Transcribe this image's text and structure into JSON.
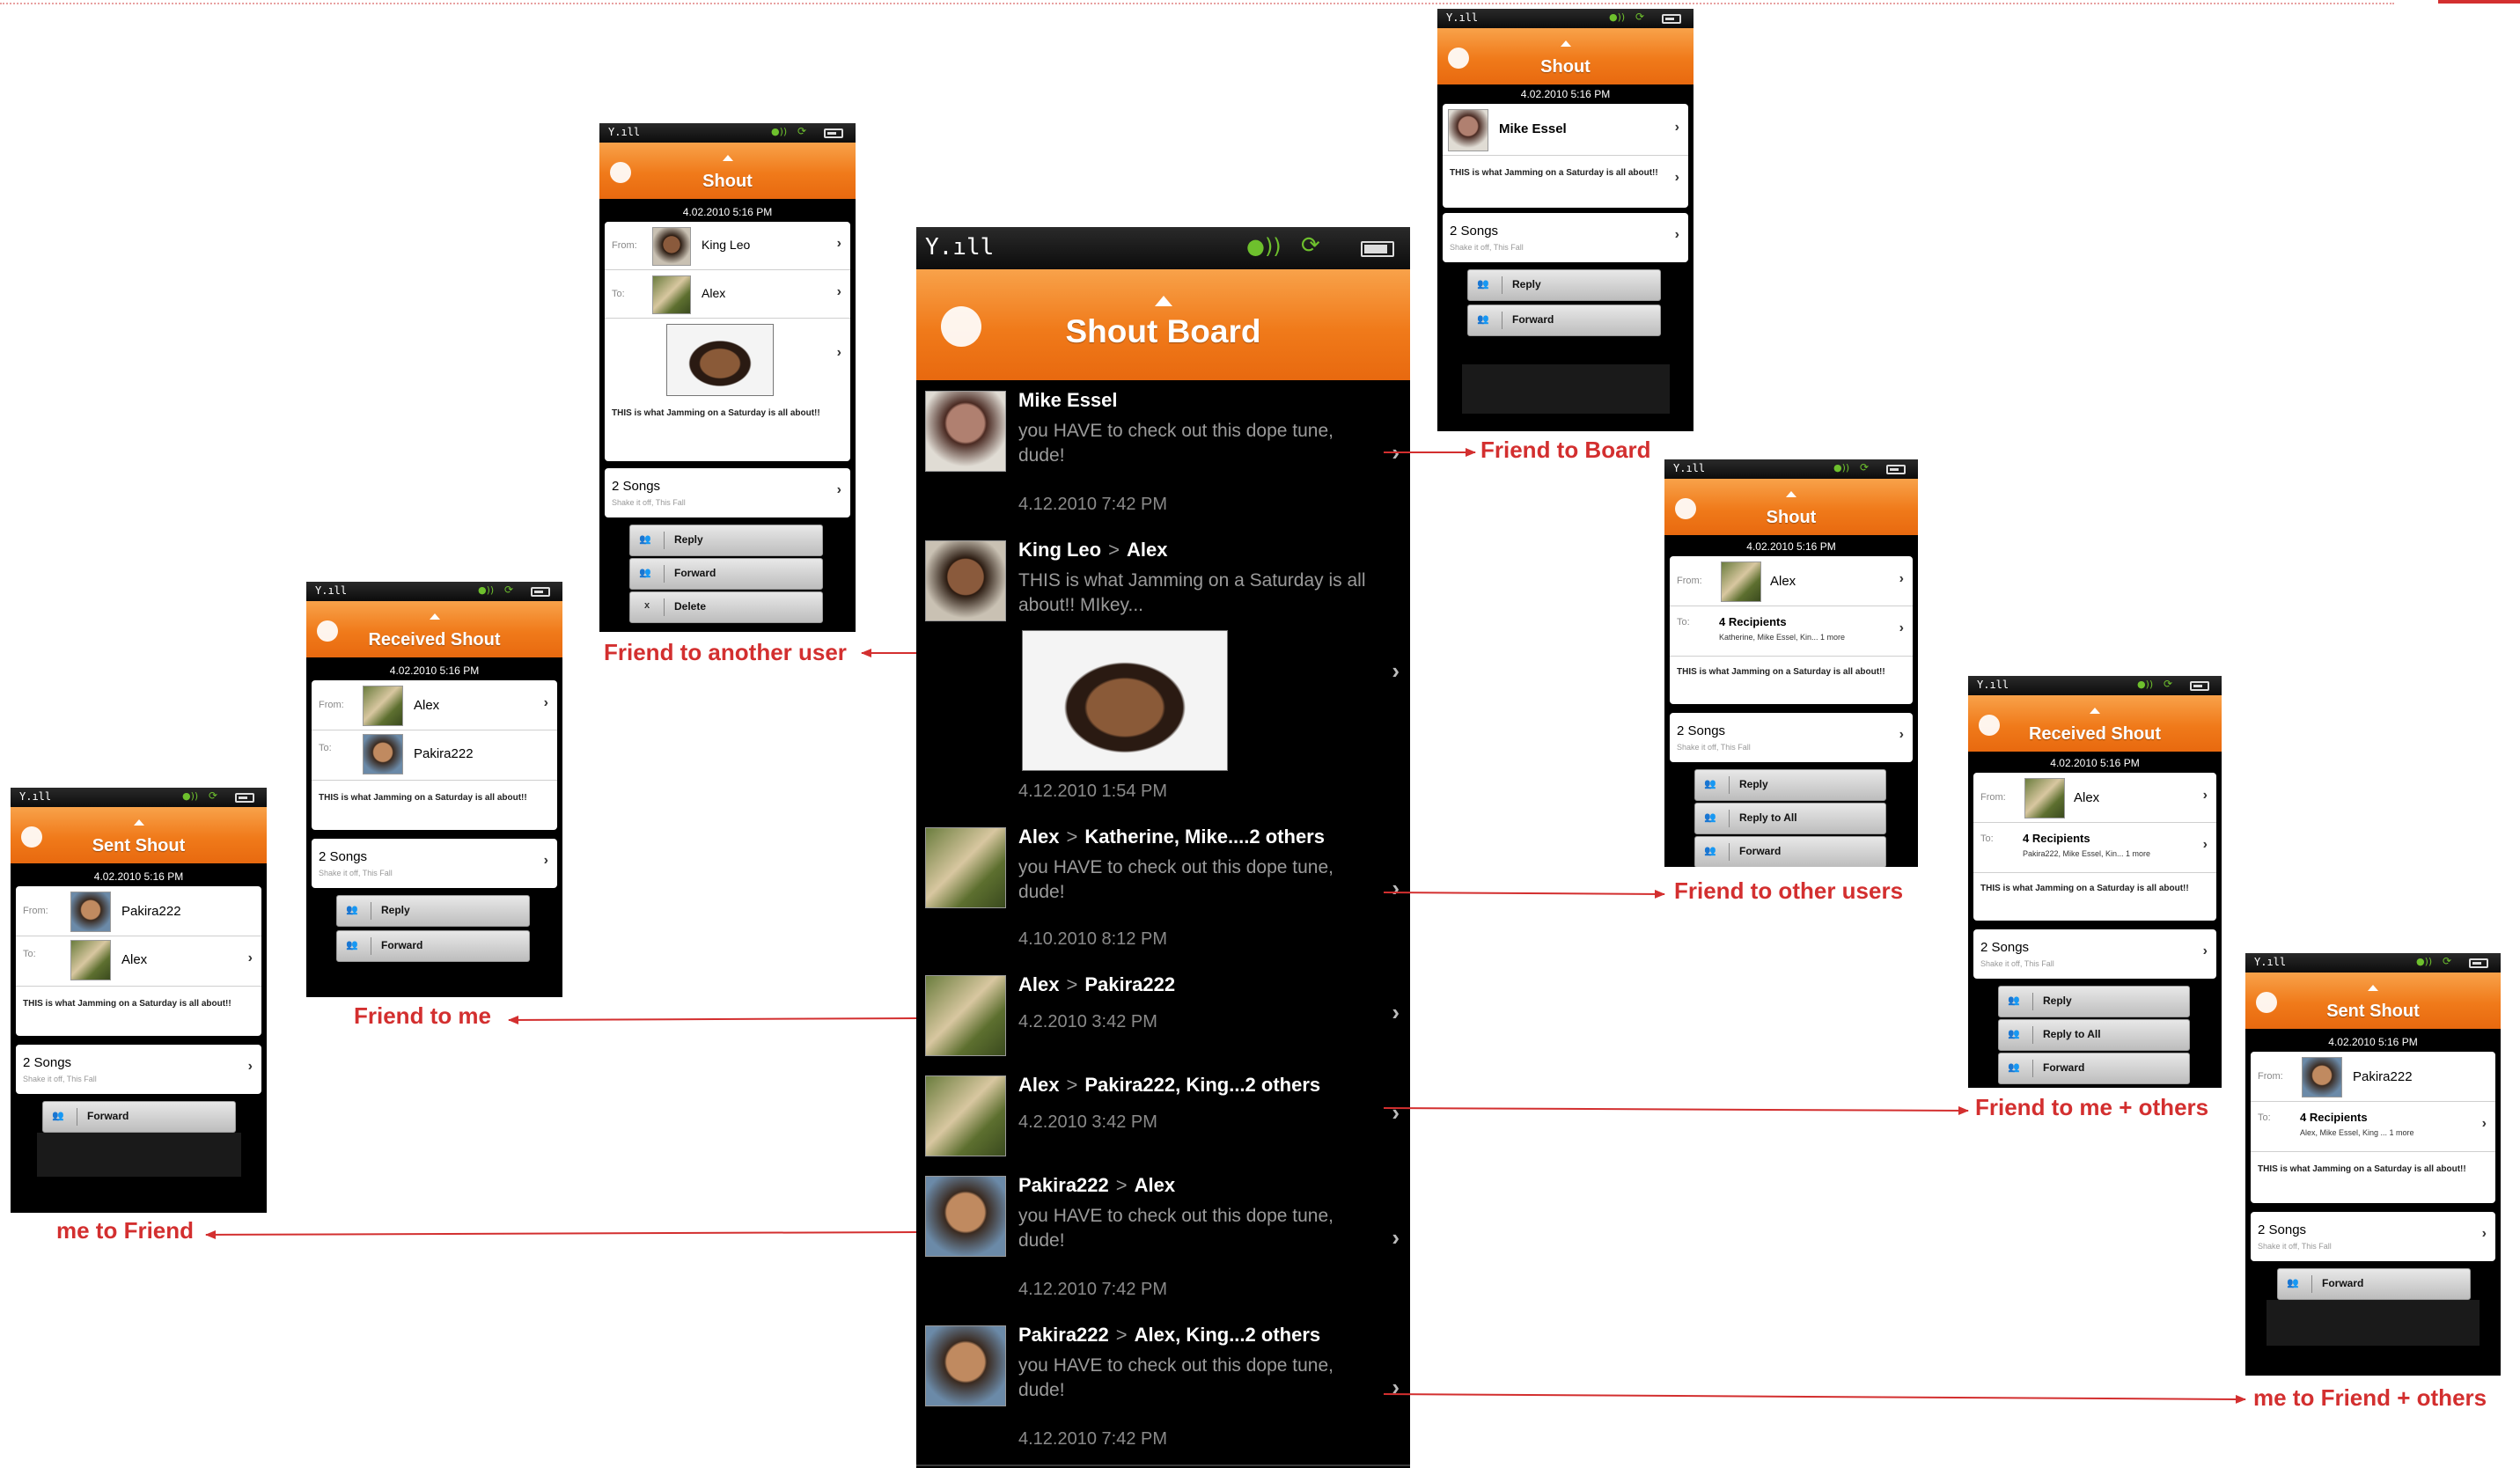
{
  "board": {
    "title": "Shout Board",
    "items": [
      {
        "name": "Mike Essel",
        "sep": "",
        "to": "",
        "text": "you HAVE to check out this dope tune, dude!",
        "date": "4.12.2010 7:42 PM",
        "avatar": "mike"
      },
      {
        "name": "King Leo",
        "sep": ">",
        "to": "Alex",
        "text": "THIS is what Jamming on a Saturday is all about!! MIkey...",
        "date": "4.12.2010 1:54 PM",
        "avatar": "leo"
      },
      {
        "name": "Alex",
        "sep": ">",
        "to": "Katherine, Mike....2 others",
        "text": "you HAVE to check out this dope tune, dude!",
        "date": "4.10.2010 8:12 PM",
        "avatar": "alex"
      },
      {
        "name": "Alex",
        "sep": ">",
        "to": "Pakira222",
        "text": "",
        "date": "4.2.2010 3:42 PM",
        "avatar": "alex"
      },
      {
        "name": "Alex",
        "sep": ">",
        "to": "Pakira222, King...2 others",
        "text": "",
        "date": "4.2.2010 3:42 PM",
        "avatar": "alex"
      },
      {
        "name": "Pakira222",
        "sep": ">",
        "to": "Alex",
        "text": "you HAVE to check out this dope tune, dude!",
        "date": "4.12.2010 7:42 PM",
        "avatar": "pak"
      },
      {
        "name": "Pakira222",
        "sep": ">",
        "to": "Alex, King...2 others",
        "text": "you HAVE to check out this dope tune, dude!",
        "date": "4.12.2010 7:42 PM",
        "avatar": "pak"
      }
    ]
  },
  "screens": {
    "friend_board": {
      "title": "Shout",
      "date": "4.02.2010 5:16 PM",
      "name": "Mike Essel",
      "message": "THIS is what Jamming on a Saturday is all about!!",
      "songs": "2 Songs",
      "songs_sub": "Shake it off, This Fall",
      "buttons": [
        "Reply",
        "Forward"
      ]
    },
    "friend_another": {
      "title": "Shout",
      "date": "4.02.2010 5:16 PM",
      "from_label": "From:",
      "from": "King Leo",
      "to_label": "To:",
      "to": "Alex",
      "message": "THIS is what Jamming on a Saturday is all about!!",
      "songs": "2 Songs",
      "songs_sub": "Shake it off, This Fall",
      "buttons": [
        "Reply",
        "Forward",
        "Delete"
      ],
      "delete_icon": "x"
    },
    "friend_me": {
      "title": "Received Shout",
      "date": "4.02.2010 5:16 PM",
      "from_label": "From:",
      "from": "Alex",
      "to_label": "To:",
      "to": "Pakira222",
      "message": "THIS is what Jamming on a Saturday is all about!!",
      "songs": "2 Songs",
      "songs_sub": "Shake it off, This Fall",
      "buttons": [
        "Reply",
        "Forward"
      ]
    },
    "me_friend": {
      "title": "Sent Shout",
      "date": "4.02.2010 5:16 PM",
      "from_label": "From:",
      "from": "Pakira222",
      "to_label": "To:",
      "to": "Alex",
      "message": "THIS is what Jamming on a Saturday is all about!!",
      "songs": "2 Songs",
      "songs_sub": "Shake it off, This Fall",
      "buttons": [
        "Forward"
      ]
    },
    "friend_others": {
      "title": "Shout",
      "date": "4.02.2010 5:16 PM",
      "from_label": "From:",
      "from": "Alex",
      "to_label": "To:",
      "to": "4 Recipients",
      "to_sub": "Katherine, Mike Essel, Kin... 1 more",
      "message": "THIS is what Jamming on a Saturday is all about!!",
      "songs": "2 Songs",
      "songs_sub": "Shake it off, This Fall",
      "buttons": [
        "Reply",
        "Reply to All",
        "Forward"
      ]
    },
    "friend_me_others": {
      "title": "Received Shout",
      "date": "4.02.2010 5:16 PM",
      "from_label": "From:",
      "from": "Alex",
      "to_label": "To:",
      "to": "4 Recipients",
      "to_sub": "Pakira222, Mike Essel, Kin... 1 more",
      "message": "THIS is what Jamming on a Saturday is all about!!",
      "songs": "2 Songs",
      "songs_sub": "Shake it off, This Fall",
      "buttons": [
        "Reply",
        "Reply to All",
        "Forward"
      ]
    },
    "me_friend_others": {
      "title": "Sent Shout",
      "date": "4.02.2010 5:16 PM",
      "from_label": "From:",
      "from": "Pakira222",
      "to_label": "To:",
      "to": "4 Recipients",
      "to_sub": "Alex, Mike Essel, King ... 1 more",
      "message": "THIS is what Jamming on a Saturday is all about!!",
      "songs": "2 Songs",
      "songs_sub": "Shake it off, This Fall",
      "buttons": [
        "Forward"
      ]
    }
  },
  "captions": {
    "friend_board": "Friend to Board",
    "friend_another": "Friend to another user",
    "friend_me": "Friend to me",
    "me_friend": "me to Friend",
    "friend_others": "Friend to other users",
    "friend_me_others": "Friend to me + others",
    "me_friend_others": "me to Friend + others"
  },
  "colors": {
    "accent": "#f07a1a",
    "arrow": "#d32f2f",
    "status_green": "#6ec02d"
  },
  "icons": {
    "signal": "signal-icon",
    "chat": "chat-icon",
    "sync": "sync-icon",
    "battery": "battery-icon",
    "chevron": "chevron-right-icon",
    "reply": "people-icon"
  }
}
